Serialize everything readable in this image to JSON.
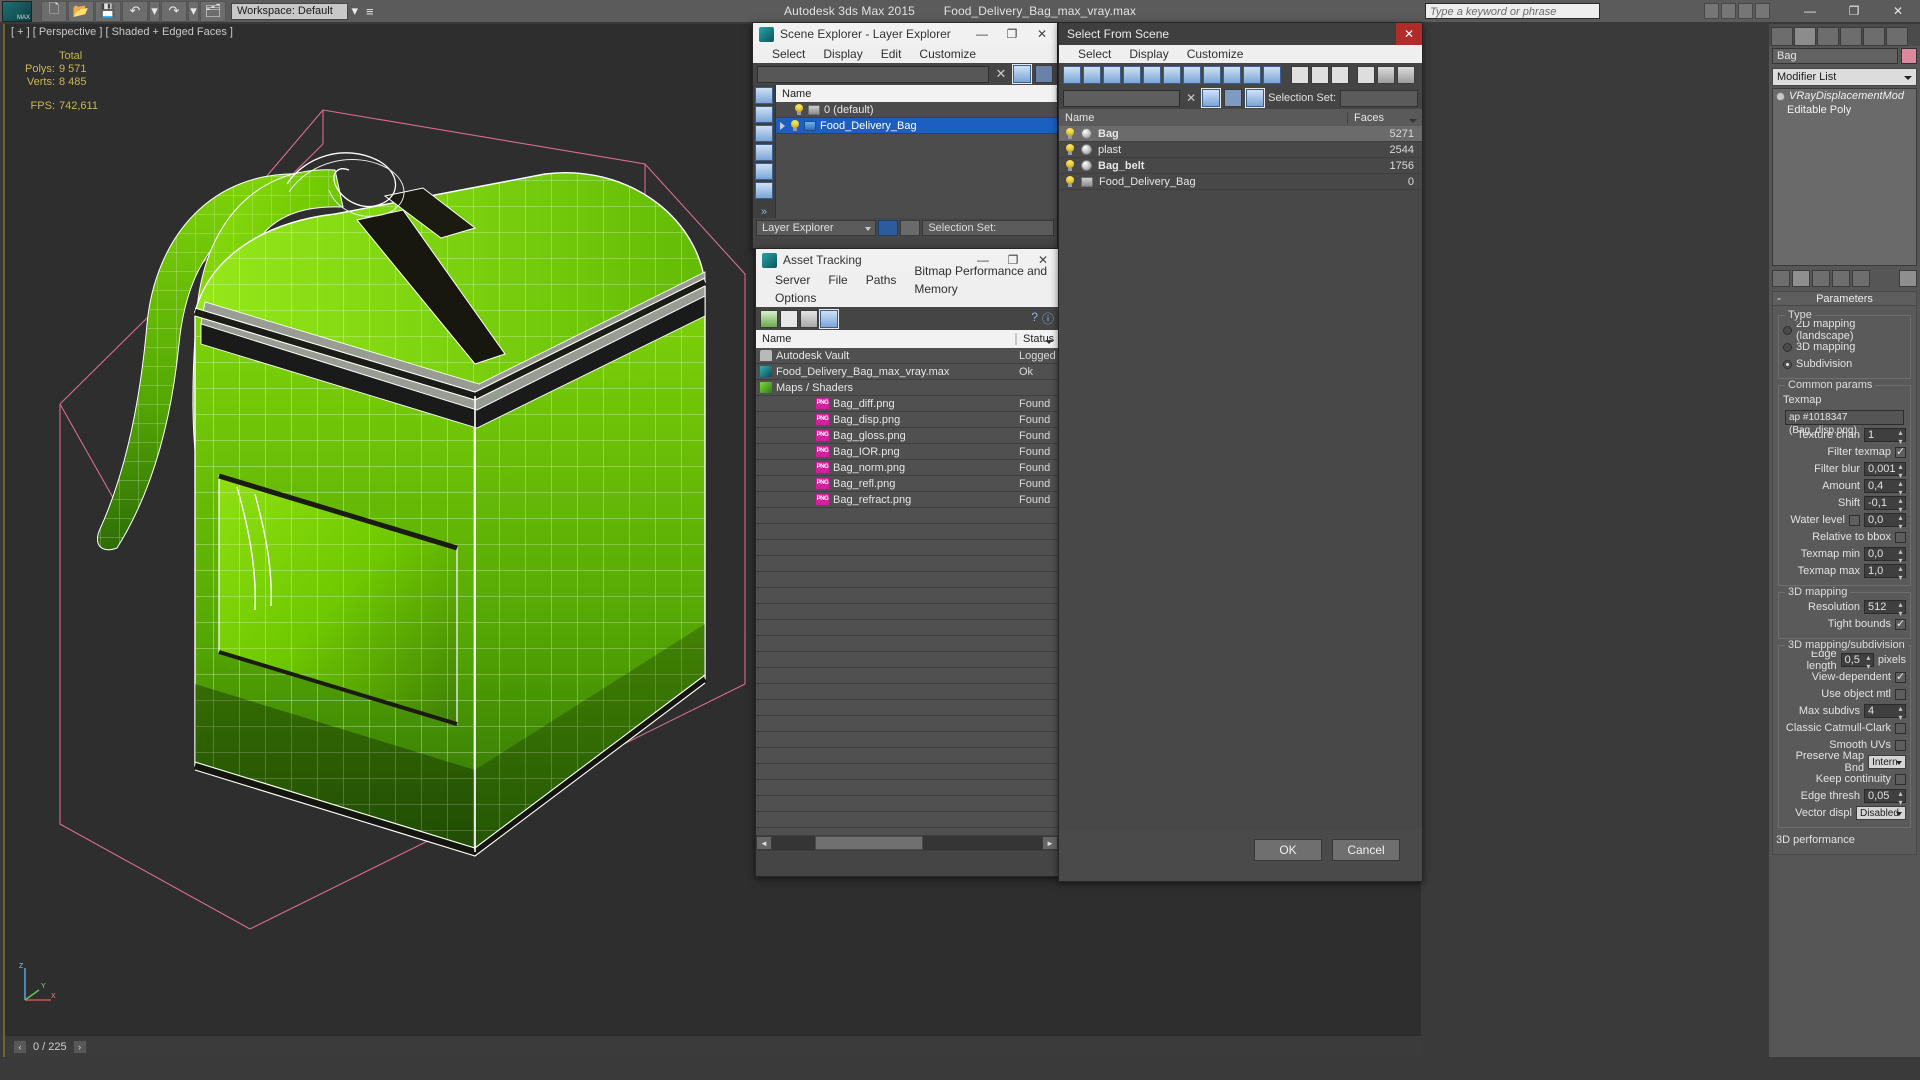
{
  "titlebar": {
    "app": "Autodesk 3ds Max  2015",
    "file": "Food_Delivery_Bag_max_vray.max",
    "search_placeholder": "Type a keyword or phrase",
    "minimize": "—",
    "maximize": "❐",
    "close": "✕"
  },
  "maintoolbar": {
    "workspace": "Workspace: Default",
    "new_icon": "new-file-icon",
    "open_icon": "open-file-icon",
    "save_icon": "save-icon",
    "undo_icon": "undo-icon",
    "redo_icon": "redo-icon",
    "link_icon": "project-folder-icon"
  },
  "viewport": {
    "label": "[ + ] [ Perspective ] [ Shaded + Edged Faces ]",
    "stats": {
      "total_header": "Total",
      "polys_label": "Polys:",
      "polys_value": "9 571",
      "verts_label": "Verts:",
      "verts_value": "8 485",
      "fps_label": "FPS:",
      "fps_value": "742,611"
    },
    "axis": {
      "z": "Z",
      "y": "Y",
      "x": "X"
    }
  },
  "status": {
    "frame_current": "0 / 225",
    "prev": "‹",
    "next": "›"
  },
  "scene_explorer": {
    "title": "Scene Explorer - Layer Explorer",
    "menus": [
      "Select",
      "Display",
      "Edit",
      "Customize"
    ],
    "search_value": "",
    "clear_icon": "clear-x-icon",
    "filter_icon": "filter-icon",
    "layers_icon": "layers-icon",
    "columns": [
      "Name"
    ],
    "rows": [
      {
        "name": "0 (default)",
        "selected": false,
        "expandable": false
      },
      {
        "name": "Food_Delivery_Bag",
        "selected": true,
        "expandable": true
      }
    ],
    "footer": {
      "mode_label": "Layer Explorer",
      "selset_label": "Selection Set:",
      "layer_btn": "layer-toggle-button",
      "node_btn": "node-toggle-button"
    },
    "side_buttons": [
      "geometry-filter",
      "shapes-filter",
      "lights-filter",
      "cameras-filter",
      "helpers-filter",
      "spacewarps-filter"
    ]
  },
  "asset_tracking": {
    "title": "Asset Tracking",
    "menus": [
      "Server",
      "File",
      "Paths",
      "Bitmap Performance and Memory",
      "Options"
    ],
    "toolbar_icons": [
      "refresh-icon",
      "list-view-icon",
      "detail-view-icon",
      "grid-view-icon"
    ],
    "columns": [
      "Name",
      "Status"
    ],
    "rows": [
      {
        "name": "Autodesk Vault",
        "status": "Logged",
        "icon": "vault-icon",
        "indent": 0
      },
      {
        "name": "Food_Delivery_Bag_max_vray.max",
        "status": "Ok",
        "icon": "max-file-icon",
        "indent": 1
      },
      {
        "name": "Maps / Shaders",
        "status": "",
        "icon": "maps-icon",
        "indent": 2
      },
      {
        "name": "Bag_diff.png",
        "status": "Found",
        "icon": "png-icon",
        "indent": 3
      },
      {
        "name": "Bag_disp.png",
        "status": "Found",
        "icon": "png-icon",
        "indent": 3
      },
      {
        "name": "Bag_gloss.png",
        "status": "Found",
        "icon": "png-icon",
        "indent": 3
      },
      {
        "name": "Bag_IOR.png",
        "status": "Found",
        "icon": "png-icon",
        "indent": 3
      },
      {
        "name": "Bag_norm.png",
        "status": "Found",
        "icon": "png-icon",
        "indent": 3
      },
      {
        "name": "Bag_refl.png",
        "status": "Found",
        "icon": "png-icon",
        "indent": 3
      },
      {
        "name": "Bag_refract.png",
        "status": "Found",
        "icon": "png-icon",
        "indent": 3
      }
    ],
    "help_icon": "help-icon",
    "info_icon": "info-icon",
    "scroll_left": "◄",
    "scroll_right": "►"
  },
  "select_from_scene": {
    "title": "Select From Scene",
    "menus": [
      "Select",
      "Display",
      "Customize"
    ],
    "search_value": "",
    "selset_label": "Selection Set:",
    "columns": [
      "Name",
      "Faces"
    ],
    "rows": [
      {
        "name": "Bag",
        "faces": "5271",
        "highlight": true,
        "icon": "sphere-icon"
      },
      {
        "name": "plast",
        "faces": "2544",
        "highlight": false,
        "icon": "sphere-icon"
      },
      {
        "name": "Bag_belt",
        "faces": "1756",
        "highlight": false,
        "icon": "sphere-icon"
      },
      {
        "name": "Food_Delivery_Bag",
        "faces": "0",
        "highlight": false,
        "icon": "group-icon"
      }
    ],
    "ok_label": "OK",
    "cancel_label": "Cancel",
    "clear_icon": "clear-x-icon",
    "filter_icon": "filter-icon"
  },
  "command_panel": {
    "object_name": "Bag",
    "object_color": "#d98a9b",
    "modifier_list_label": "Modifier List",
    "stack": [
      {
        "label": "VRayDisplacementMod",
        "italic": true
      },
      {
        "label": "Editable Poly",
        "italic": false
      }
    ],
    "parameters": {
      "rollout_title": "Parameters",
      "type_group": "Type",
      "type_options": [
        {
          "label": "2D mapping (landscape)",
          "selected": false
        },
        {
          "label": "3D mapping",
          "selected": false
        },
        {
          "label": "Subdivision",
          "selected": true
        }
      ],
      "common_group": "Common params",
      "texmap_label": "Texmap",
      "texmap_value": "ap #1018347 (Bag_disp.png)",
      "texture_chan_label": "Texture chan",
      "texture_chan_value": "1",
      "filter_texmap_label": "Filter texmap",
      "filter_texmap_checked": true,
      "filter_blur_label": "Filter blur",
      "filter_blur_value": "0,001",
      "amount_label": "Amount",
      "amount_value": "0,4",
      "shift_label": "Shift",
      "shift_value": "-0,1",
      "water_level_label": "Water level",
      "water_level_checked": false,
      "water_level_value": "0,0",
      "relative_to_bbox_label": "Relative to bbox",
      "relative_to_bbox_checked": false,
      "texmap_min_label": "Texmap min",
      "texmap_min_value": "0,0",
      "texmap_max_label": "Texmap max",
      "texmap_max_value": "1,0",
      "mapping3d_group": "3D mapping",
      "resolution_label": "Resolution",
      "resolution_value": "512",
      "tight_bounds_label": "Tight bounds",
      "tight_bounds_checked": true,
      "subdiv_group": "3D mapping/subdivision",
      "edge_length_label": "Edge length",
      "edge_length_value": "0,5",
      "edge_length_units": "pixels",
      "view_dependent_label": "View-dependent",
      "view_dependent_checked": true,
      "use_object_mtl_label": "Use object mtl",
      "use_object_mtl_checked": false,
      "max_subdivs_label": "Max subdivs",
      "max_subdivs_value": "4",
      "classic_catmull_label": "Classic Catmull-Clark",
      "classic_catmull_checked": false,
      "smooth_uvs_label": "Smooth UVs",
      "smooth_uvs_checked": false,
      "preserve_map_label": "Preserve Map Bnd",
      "preserve_map_value": "Intern",
      "keep_continuity_label": "Keep continuity",
      "keep_continuity_checked": false,
      "edge_thresh_label": "Edge thresh",
      "edge_thresh_value": "0,05",
      "vector_displ_label": "Vector displ",
      "vector_displ_value": "Disabled",
      "performance_group": "3D performance"
    }
  }
}
